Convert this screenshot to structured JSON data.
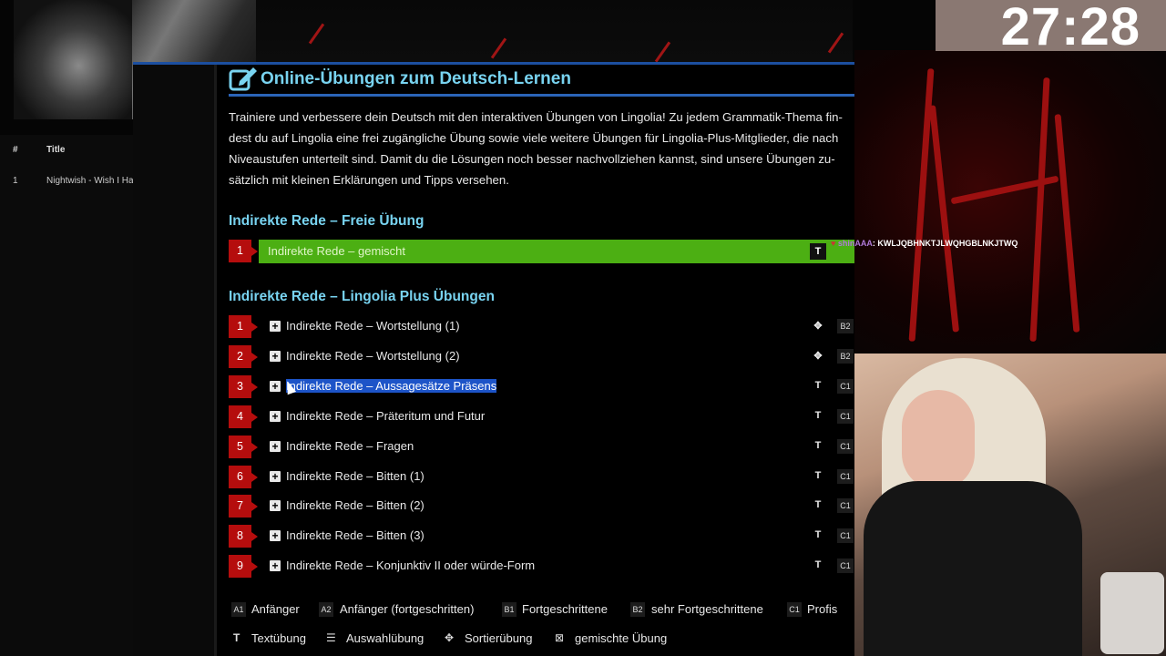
{
  "timer": "27:28",
  "playlist": {
    "headers": [
      "#",
      "Title"
    ],
    "rows": [
      {
        "num": "1",
        "title": "Nightwish - Wish I Ha"
      }
    ]
  },
  "page": {
    "title": "Online-Übungen zum Deutsch-Lernen",
    "intro": [
      "Trainiere und verbessere dein Deutsch mit den interaktiven Übungen von Lingolia! Zu jedem Grammatik-Thema fin-",
      "dest du auf Lingolia eine frei zugängliche Übung sowie viele weitere Übungen für Lingolia-Plus-Mitglieder, die nach",
      "Niveaustufen unterteilt sind. Damit du die Lösungen noch besser nachvollziehen kannst, sind unsere Übungen zu-",
      "sätzlich mit kleinen Erklärungen und Tipps versehen."
    ],
    "free_section": {
      "heading": "Indirekte Rede – Freie Übung",
      "item": {
        "num": "1",
        "label": "Indirekte Rede – gemischt",
        "type": "T"
      }
    },
    "plus_section": {
      "heading": "Indirekte Rede – Lingolia Plus Übungen",
      "items": [
        {
          "num": "1",
          "label": "Indirekte Rede – Wortstellung (1)",
          "type": "✥",
          "level": "B2"
        },
        {
          "num": "2",
          "label": "Indirekte Rede – Wortstellung (2)",
          "type": "✥",
          "level": "B2"
        },
        {
          "num": "3",
          "label": "Indirekte Rede – Aussagesätze Präsens",
          "type": "T",
          "level": "C1",
          "selected": true
        },
        {
          "num": "4",
          "label": "Indirekte Rede – Präteritum und Futur",
          "type": "T",
          "level": "C1"
        },
        {
          "num": "5",
          "label": "Indirekte Rede – Fragen",
          "type": "T",
          "level": "C1"
        },
        {
          "num": "6",
          "label": "Indirekte Rede – Bitten (1)",
          "type": "T",
          "level": "C1"
        },
        {
          "num": "7",
          "label": "Indirekte Rede – Bitten (2)",
          "type": "T",
          "level": "C1"
        },
        {
          "num": "8",
          "label": "Indirekte Rede – Bitten (3)",
          "type": "T",
          "level": "C1"
        },
        {
          "num": "9",
          "label": "Indirekte Rede – Konjunktiv II oder würde-Form",
          "type": "T",
          "level": "C1"
        }
      ]
    },
    "legend_levels": [
      {
        "badge": "A1",
        "label": "Anfänger"
      },
      {
        "badge": "A2",
        "label": "Anfänger (fortgeschritten)"
      },
      {
        "badge": "B1",
        "label": "Fortgeschrittene"
      },
      {
        "badge": "B2",
        "label": "sehr Fortgeschrittene"
      },
      {
        "badge": "C1",
        "label": "Profis"
      }
    ],
    "legend_types": [
      {
        "icon": "T",
        "label": "Textübung"
      },
      {
        "icon": "☰",
        "label": "Auswahlübung"
      },
      {
        "icon": "✥",
        "label": "Sortierübung"
      },
      {
        "icon": "⊠",
        "label": "gemischte Übung"
      }
    ]
  },
  "chat": {
    "user": "shinAAA",
    "message": ": KWLJQBHNKTJLWQHGBLNKJTWQ"
  }
}
